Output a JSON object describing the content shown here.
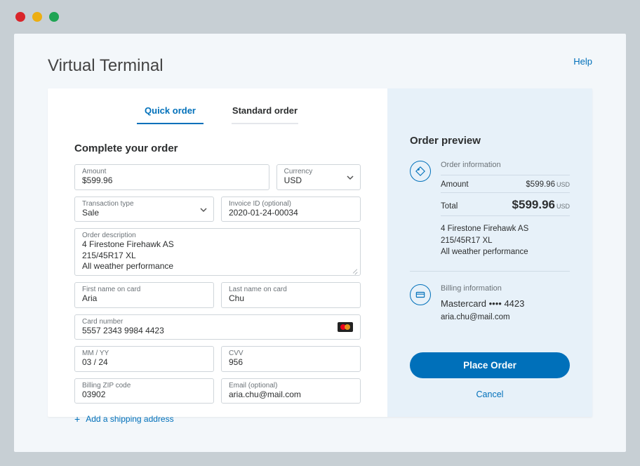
{
  "header": {
    "title": "Virtual Terminal",
    "help": "Help"
  },
  "tabs": {
    "quick": "Quick order",
    "standard": "Standard order"
  },
  "form": {
    "section_title": "Complete your order",
    "amount": {
      "label": "Amount",
      "value": "$599.96"
    },
    "currency": {
      "label": "Currency",
      "value": "USD"
    },
    "transaction_type": {
      "label": "Transaction type",
      "value": "Sale"
    },
    "invoice": {
      "label": "Invoice ID (optional)",
      "value": "2020-01-24-00034"
    },
    "description": {
      "label": "Order description",
      "value": "4 Firestone Firehawk AS\n215/45R17 XL\nAll weather performance"
    },
    "first_name": {
      "label": "First name on card",
      "value": "Aria"
    },
    "last_name": {
      "label": "Last name on card",
      "value": "Chu"
    },
    "card_number": {
      "label": "Card number",
      "value": "5557 2343 9984 4423"
    },
    "expiry": {
      "label": "MM / YY",
      "value": "03 / 24"
    },
    "cvv": {
      "label": "CVV",
      "value": "956"
    },
    "zip": {
      "label": "Billing ZIP code",
      "value": "03902"
    },
    "email": {
      "label": "Email (optional)",
      "value": "aria.chu@mail.com"
    },
    "add_shipping": "Add a shipping address"
  },
  "preview": {
    "title": "Order preview",
    "order_info_label": "Order information",
    "amount_label": "Amount",
    "amount_value": "$599.96",
    "total_label": "Total",
    "total_value": "$599.96",
    "currency_suffix": "USD",
    "desc_line1": "4 Firestone Firehawk AS",
    "desc_line2": "215/45R17 XL",
    "desc_line3": "All weather performance",
    "billing_label": "Billing information",
    "card_masked": "Mastercard •••• 4423",
    "email": "aria.chu@mail.com",
    "place_order": "Place Order",
    "cancel": "Cancel"
  }
}
